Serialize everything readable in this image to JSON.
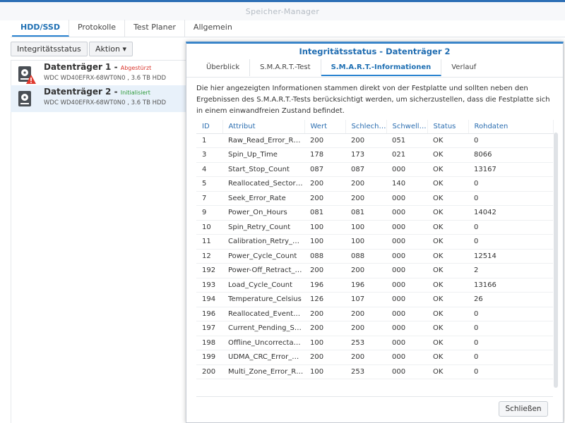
{
  "window": {
    "title": "Speicher-Manager"
  },
  "main_tabs": [
    "HDD/SSD",
    "Protokolle",
    "Test Planer",
    "Allgemein"
  ],
  "toolbar": {
    "status_button": "Integritätsstatus",
    "action_button": "Aktion ▾"
  },
  "disks": [
    {
      "name": "Datenträger 1",
      "status": "Abgestürzt",
      "status_color": "#d9342b",
      "model": "WDC WD40EFRX-68WT0N0 , 3.6 TB HDD"
    },
    {
      "name": "Datenträger 2",
      "status": "Initialisiert",
      "status_color": "#2e9a3a",
      "model": "WDC WD40EFRX-68WT0N0 , 3.6 TB HDD"
    }
  ],
  "dialog": {
    "title": "Integritätsstatus - Datenträger 2",
    "tabs": [
      "Überblick",
      "S.M.A.R.T.-Test",
      "S.M.A.R.T.-Informationen",
      "Verlauf"
    ],
    "description": "Die hier angezeigten Informationen stammen direkt von der Festplatte und sollten neben den Ergebnissen des S.M.A.R.T.-Tests berücksichtigt werden, um sicherzustellen, dass die Festplatte sich in einem einwandfreien Zustand befindet.",
    "columns": [
      "ID",
      "Attribut",
      "Wert",
      "Schlech…",
      "Schwell…",
      "Status",
      "Rohdaten"
    ],
    "rows": [
      [
        "1",
        "Raw_Read_Error_R…",
        "200",
        "200",
        "051",
        "OK",
        "0"
      ],
      [
        "3",
        "Spin_Up_Time",
        "178",
        "173",
        "021",
        "OK",
        "8066"
      ],
      [
        "4",
        "Start_Stop_Count",
        "087",
        "087",
        "000",
        "OK",
        "13167"
      ],
      [
        "5",
        "Reallocated_Sector…",
        "200",
        "200",
        "140",
        "OK",
        "0"
      ],
      [
        "7",
        "Seek_Error_Rate",
        "200",
        "200",
        "000",
        "OK",
        "0"
      ],
      [
        "9",
        "Power_On_Hours",
        "081",
        "081",
        "000",
        "OK",
        "14042"
      ],
      [
        "10",
        "Spin_Retry_Count",
        "100",
        "100",
        "000",
        "OK",
        "0"
      ],
      [
        "11",
        "Calibration_Retry_…",
        "100",
        "100",
        "000",
        "OK",
        "0"
      ],
      [
        "12",
        "Power_Cycle_Count",
        "088",
        "088",
        "000",
        "OK",
        "12514"
      ],
      [
        "192",
        "Power-Off_Retract_…",
        "200",
        "200",
        "000",
        "OK",
        "2"
      ],
      [
        "193",
        "Load_Cycle_Count",
        "196",
        "196",
        "000",
        "OK",
        "13166"
      ],
      [
        "194",
        "Temperature_Celsius",
        "126",
        "107",
        "000",
        "OK",
        "26"
      ],
      [
        "196",
        "Reallocated_Event…",
        "200",
        "200",
        "000",
        "OK",
        "0"
      ],
      [
        "197",
        "Current_Pending_S…",
        "200",
        "200",
        "000",
        "OK",
        "0"
      ],
      [
        "198",
        "Offline_Uncorrectab…",
        "100",
        "253",
        "000",
        "OK",
        "0"
      ],
      [
        "199",
        "UDMA_CRC_Error_…",
        "200",
        "200",
        "000",
        "OK",
        "0"
      ],
      [
        "200",
        "Multi_Zone_Error_R…",
        "100",
        "253",
        "000",
        "OK",
        "0"
      ]
    ],
    "close_button": "Schließen"
  },
  "icons": {
    "disk": "hard-disk-icon",
    "warning": "warning-icon"
  }
}
